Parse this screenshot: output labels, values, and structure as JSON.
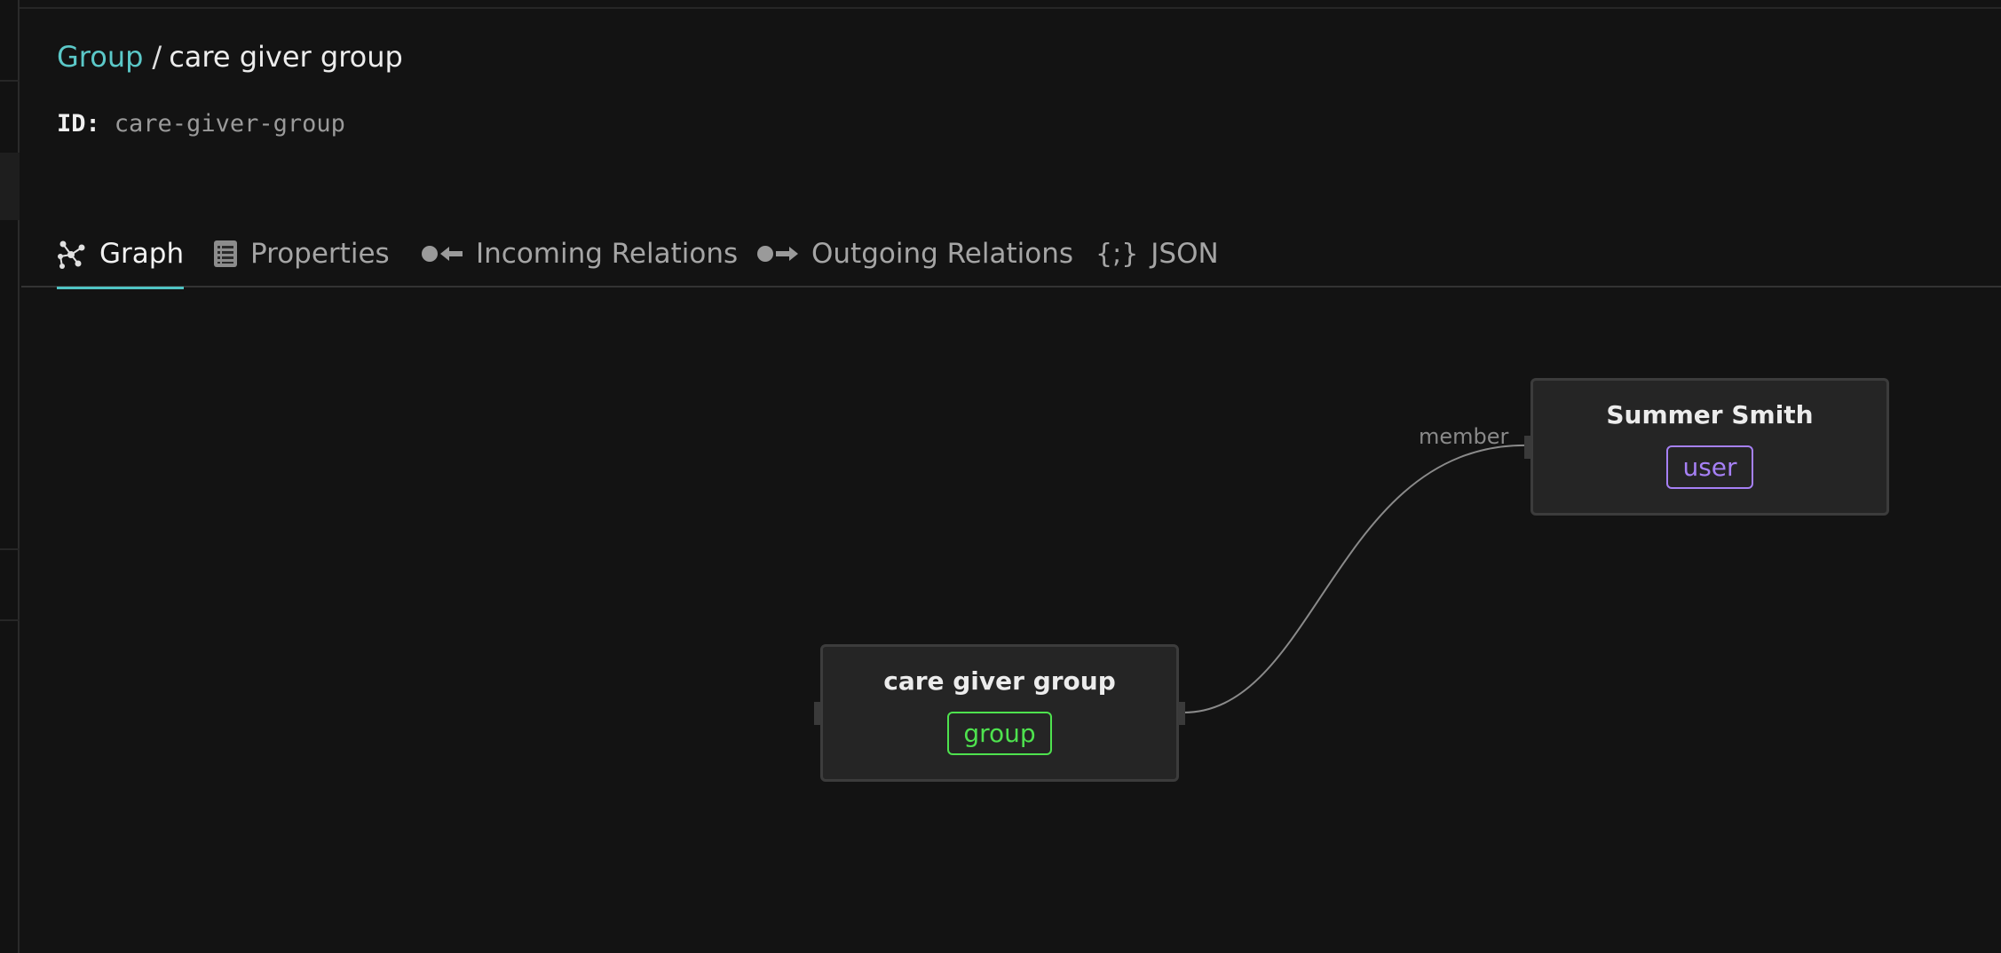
{
  "breadcrumb": {
    "parent": "Group",
    "separator": "/",
    "current": "care giver group"
  },
  "id_row": {
    "label": "ID:",
    "value": "care-giver-group"
  },
  "tabs": [
    {
      "label": "Graph",
      "icon": "graph-icon",
      "active": true
    },
    {
      "label": "Properties",
      "icon": "properties-icon",
      "active": false
    },
    {
      "label": "Incoming Relations",
      "icon": "incoming-relations-icon",
      "active": false
    },
    {
      "label": "Outgoing Relations",
      "icon": "outgoing-relations-icon",
      "active": false
    },
    {
      "label": "JSON",
      "icon": "json-icon",
      "active": false
    }
  ],
  "json_icon_glyph": "{;}",
  "graph": {
    "nodes": [
      {
        "title": "care giver group",
        "type": "group"
      },
      {
        "title": "Summer Smith",
        "type": "user"
      }
    ],
    "edges": [
      {
        "from": "care giver group",
        "to": "Summer Smith",
        "label": "member"
      }
    ]
  },
  "colors": {
    "background": "#131313",
    "accent": "#4fc4c4",
    "link": "#5bc8c8",
    "group_badge": "#4ee24e",
    "user_badge": "#a680f5",
    "node_bg": "#252525",
    "edge": "#8a8a8a"
  }
}
